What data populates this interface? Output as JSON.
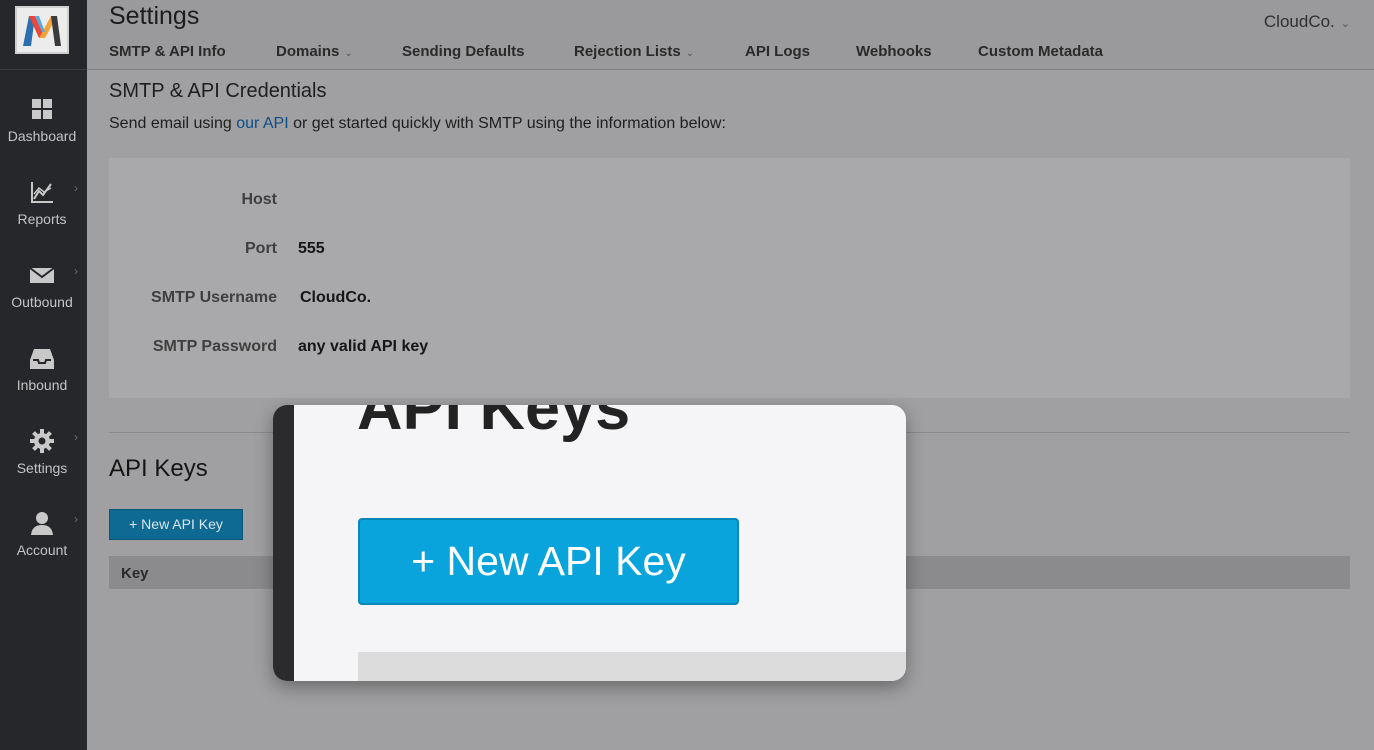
{
  "app": {
    "logo_letter": "M"
  },
  "sidebar": {
    "items": [
      {
        "label": "Dashboard",
        "icon": "dashboard-grid-icon",
        "has_submenu": false
      },
      {
        "label": "Reports",
        "icon": "chart-icon",
        "has_submenu": true
      },
      {
        "label": "Outbound",
        "icon": "envelope-icon",
        "has_submenu": true
      },
      {
        "label": "Inbound",
        "icon": "inbox-icon",
        "has_submenu": false
      },
      {
        "label": "Settings",
        "icon": "gear-icon",
        "has_submenu": true
      },
      {
        "label": "Account",
        "icon": "user-icon",
        "has_submenu": true
      }
    ]
  },
  "header": {
    "title": "Settings",
    "org": "CloudCo.",
    "tabs": [
      {
        "label": "SMTP & API Info",
        "dropdown": false
      },
      {
        "label": "Domains",
        "dropdown": true
      },
      {
        "label": "Sending Defaults",
        "dropdown": false
      },
      {
        "label": "Rejection Lists",
        "dropdown": true
      },
      {
        "label": "API Logs",
        "dropdown": false
      },
      {
        "label": "Webhooks",
        "dropdown": false
      },
      {
        "label": "Custom Metadata",
        "dropdown": false
      }
    ]
  },
  "credentials": {
    "title": "SMTP & API Credentials",
    "intro_before": "Send email using ",
    "intro_link": "our API",
    "intro_after": " or get started quickly with SMTP using the information below:",
    "rows": [
      {
        "label": "Host",
        "value": ""
      },
      {
        "label": "Port",
        "value": "555"
      },
      {
        "label": "SMTP Username",
        "value": "CloudCo."
      },
      {
        "label": "SMTP Password",
        "value": "any valid API key"
      }
    ]
  },
  "api_keys": {
    "title": "API Keys",
    "new_button": "+ New API Key",
    "columns": [
      "Key"
    ]
  },
  "zoom": {
    "title": "API Keys",
    "button": "+ New API Key"
  },
  "colors": {
    "sidebar_bg": "#25272b",
    "button_blue": "#0aa4dc",
    "link_blue": "#0d4e8a"
  }
}
